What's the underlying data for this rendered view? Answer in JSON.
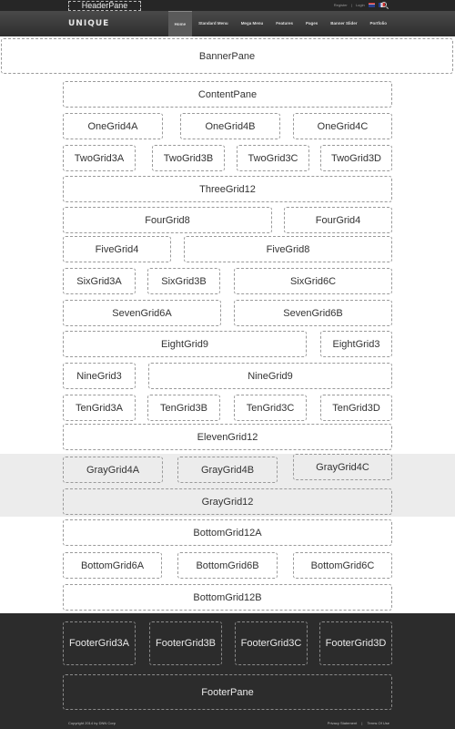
{
  "header": {
    "pane_label": "HeaderPane",
    "register": "Register",
    "separator": "|",
    "login": "Login"
  },
  "nav": {
    "logo": "UNIQUE",
    "items": [
      "Home",
      "Standard Menu",
      "Mega Menu",
      "Features",
      "Pages",
      "Banner Slider",
      "Portfolio"
    ]
  },
  "panes": {
    "banner": "BannerPane",
    "content": "ContentPane",
    "one_grid_4a": "OneGrid4A",
    "one_grid_4b": "OneGrid4B",
    "one_grid_4c": "OneGrid4C",
    "two_grid_3a": "TwoGrid3A",
    "two_grid_3b": "TwoGrid3B",
    "two_grid_3c": "TwoGrid3C",
    "two_grid_3d": "TwoGrid3D",
    "three_grid_12": "ThreeGrid12",
    "four_grid_8": "FourGrid8",
    "four_grid_4": "FourGrid4",
    "five_grid_4": "FiveGrid4",
    "five_grid_8": "FiveGrid8",
    "six_grid_3a": "SixGrid3A",
    "six_grid_3b": "SixGrid3B",
    "six_grid_6c": "SixGrid6C",
    "seven_grid_6a": "SevenGrid6A",
    "seven_grid_6b": "SevenGrid6B",
    "eight_grid_9": "EightGrid9",
    "eight_grid_3": "EightGrid3",
    "nine_grid_3": "NineGrid3",
    "nine_grid_9": "NineGrid9",
    "ten_grid_3a": "TenGrid3A",
    "ten_grid_3b": "TenGrid3B",
    "ten_grid_3c": "TenGrid3C",
    "ten_grid_3d": "TenGrid3D",
    "eleven_grid_12": "ElevenGrid12",
    "gray_grid_4a": "GrayGrid4A",
    "gray_grid_4b": "GrayGrid4B",
    "gray_grid_4c": "GrayGrid4C",
    "gray_grid_12": "GrayGrid12",
    "bottom_grid_12a": "BottomGrid12A",
    "bottom_grid_6a": "BottomGrid6A",
    "bottom_grid_6b": "BottomGrid6B",
    "bottom_grid_6c": "BottomGrid6C",
    "bottom_grid_12b": "BottomGrid12B",
    "footer_grid_3a": "FooterGrid3A",
    "footer_grid_3b": "FooterGrid3B",
    "footer_grid_3c": "FooterGrid3C",
    "footer_grid_3d": "FooterGrid3D",
    "footer": "FooterPane"
  },
  "footer": {
    "copyright": "Copyright 2014 by DNN Corp",
    "privacy": "Privacy Statement",
    "separator": "|",
    "terms": "Terms Of Use"
  },
  "colors": {
    "topbar": "#262626",
    "navbar": "#3c3c3c",
    "gray_band": "#ececec",
    "footer_bg": "#2c2c2c"
  }
}
